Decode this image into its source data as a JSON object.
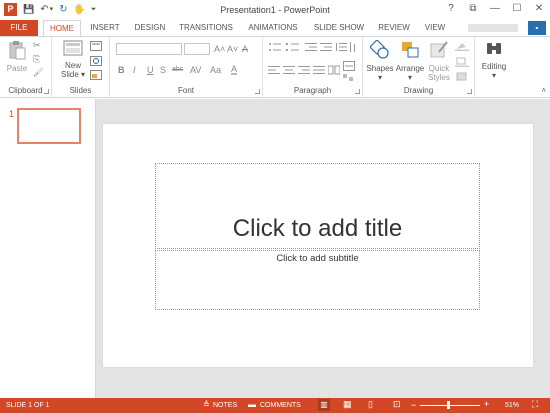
{
  "window": {
    "title": "Presentation1 - PowerPoint",
    "app_icon": "P"
  },
  "qat": {
    "save": "💾",
    "undo": "↶",
    "undo_drop": "▾",
    "redo": "↻",
    "touch": "🖐",
    "customize": "⏷"
  },
  "window_controls": {
    "help": "?",
    "ribbon_opts": "⧉",
    "minimize": "—",
    "maximize": "☐",
    "close": "✕"
  },
  "tabs": [
    "FILE",
    "HOME",
    "INSERT",
    "DESIGN",
    "TRANSITIONS",
    "ANIMATIONS",
    "SLIDE SHOW",
    "REVIEW",
    "VIEW"
  ],
  "ribbon": {
    "clipboard": {
      "label": "Clipboard",
      "paste": "Paste",
      "cut": "✂",
      "copy": "⎘",
      "painter": "🖌"
    },
    "slides": {
      "label": "Slides",
      "new_slide": "New",
      "new_slide2": "Slide ▾"
    },
    "font": {
      "label": "Font",
      "bold": "B",
      "italic": "I",
      "underline": "U",
      "strike": "S",
      "shadow": "abc",
      "spacing": "AV",
      "case": "Aa",
      "grow": "A˄",
      "shrink": "A˅",
      "clear": "A"
    },
    "paragraph": {
      "label": "Paragraph"
    },
    "drawing": {
      "label": "Drawing",
      "shapes": "Shapes",
      "arrange": "Arrange",
      "quick": "Quick",
      "styles": "Styles"
    },
    "editing": {
      "label": "Editing"
    }
  },
  "thumbnails": {
    "number": "1"
  },
  "slide": {
    "title_placeholder": "Click to add title",
    "subtitle_placeholder": "Click to add subtitle"
  },
  "statusbar": {
    "slide_info": "SLIDE 1 OF 1",
    "notes": "NOTES",
    "comments": "COMMENTS",
    "zoom": "51%",
    "minus": "−",
    "plus": "+"
  }
}
